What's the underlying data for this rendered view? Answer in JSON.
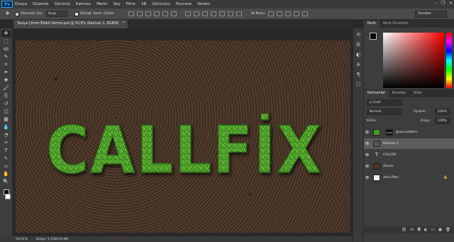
{
  "app": {
    "logo": "Ps"
  },
  "menu": [
    "Dosya",
    "Düzenle",
    "Görüntü",
    "Katman",
    "Metin",
    "Seç",
    "Filtre",
    "3B",
    "Görünüm",
    "Pencere",
    "Yardım"
  ],
  "window_controls": {
    "minimize": "–",
    "restore": "❐",
    "close": "✕"
  },
  "options": {
    "auto_select_label": "Otomatik Seç:",
    "auto_select_checked": true,
    "auto_select_mode": "Grup",
    "transform_label": "Dönüşt. Kontr. Göster",
    "transform_checked": false,
    "mode_3d": "3B Modu:",
    "workspace": "Temeller"
  },
  "document": {
    "tab_title": "Yazıya Çimen Efekti Verme.psd @ 50,9% (Katman 1, RGB/8)",
    "close_glyph": "*",
    "headline_text": "CALLFİX"
  },
  "status": {
    "zoom": "50,91%",
    "doc_info": "Belge: 1,53M/19,9M"
  },
  "color_panel": {
    "tabs": [
      "Renk",
      "Renk Örnekleri"
    ],
    "active_tab": 0,
    "foreground": "#000000",
    "background": "#ffffff"
  },
  "layers_panel": {
    "tabs": [
      "Katmanlar",
      "Kanallar",
      "Yollar"
    ],
    "active_tab": 0,
    "filter_label": "ρ Çeşit",
    "blend_mode": "Normal",
    "opacity_label": "Opaklık:",
    "opacity_value": "100%",
    "lock_label": "Kilitle:",
    "fill_label": "Dolgu:",
    "fill_value": "100%",
    "layers": [
      {
        "name": "grass-pattern",
        "thumb": "#4a9a2a",
        "selected": false,
        "kind": "image",
        "has_mask": true,
        "mask_label": "CALLFIX"
      },
      {
        "name": "Katman 1",
        "thumb": "#555555",
        "selected": true,
        "kind": "image",
        "has_mask": false
      },
      {
        "name": "CALLFİX",
        "thumb": "",
        "selected": false,
        "kind": "text",
        "has_mask": false
      },
      {
        "name": "Zemin",
        "thumb": "#4a3628",
        "selected": false,
        "kind": "image",
        "has_mask": false
      },
      {
        "name": "Arka Plan",
        "thumb": "#ffffff",
        "selected": false,
        "kind": "image",
        "has_mask": false,
        "locked": true
      }
    ],
    "text_layer_glyph": "T",
    "eye_glyph": "👁",
    "lock_glyph": "🔒",
    "bottom_icons": [
      "link-layers-icon",
      "fx-icon",
      "mask-icon",
      "adjustment-icon",
      "group-icon",
      "new-layer-icon",
      "trash-icon"
    ],
    "bottom_glyphs": [
      "⛓",
      "fx",
      "◘",
      "◐",
      "▭",
      "▣",
      "🗑"
    ]
  },
  "tools": [
    "move-tool-icon",
    "marquee-tool-icon",
    "lasso-tool-icon",
    "quick-select-tool-icon",
    "crop-tool-icon",
    "eyedropper-tool-icon",
    "healing-brush-tool-icon",
    "brush-tool-icon",
    "clone-stamp-tool-icon",
    "history-brush-tool-icon",
    "eraser-tool-icon",
    "gradient-tool-icon",
    "blur-tool-icon",
    "dodge-tool-icon",
    "pen-tool-icon",
    "type-tool-icon",
    "path-select-tool-icon",
    "shape-tool-icon",
    "hand-tool-icon",
    "zoom-tool-icon"
  ],
  "tool_glyphs": [
    "✥",
    "⬚",
    "ꝏ",
    "✎",
    "⌗",
    "✒",
    "✚",
    "🖌",
    "⎘",
    "↺",
    "◫",
    "▦",
    "💧",
    "◔",
    "✑",
    "T",
    "↖",
    "▭",
    "✋",
    "🔍"
  ]
}
